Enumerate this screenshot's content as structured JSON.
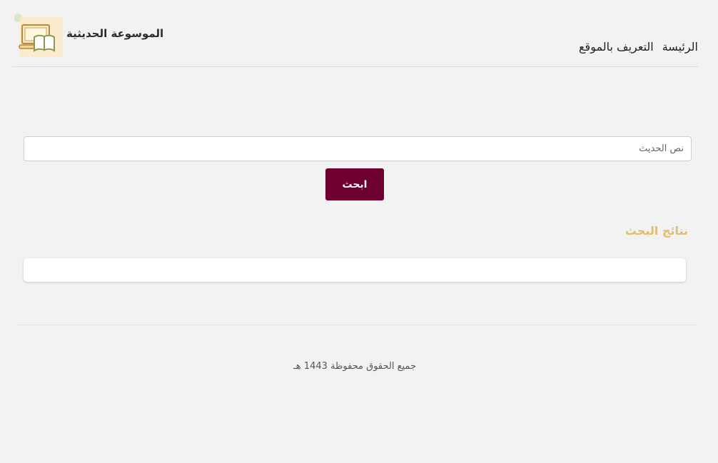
{
  "header": {
    "site_title": "الموسوعة الحديثية",
    "nav": [
      {
        "label": "الرئيسة"
      },
      {
        "label": "التعريف بالموقع"
      }
    ]
  },
  "search": {
    "placeholder": "نص الحديث",
    "value": "",
    "button_label": "ابحث"
  },
  "results": {
    "heading": "نتائج البحث"
  },
  "footer": {
    "copyright": "جميع الحقوق محفوظة 1443 هـ"
  },
  "colors": {
    "accent": "#6e0030",
    "heading": "#e0bf6c",
    "background": "#f2f2f2"
  },
  "icons": {
    "logo": "laptop-book-icon"
  }
}
